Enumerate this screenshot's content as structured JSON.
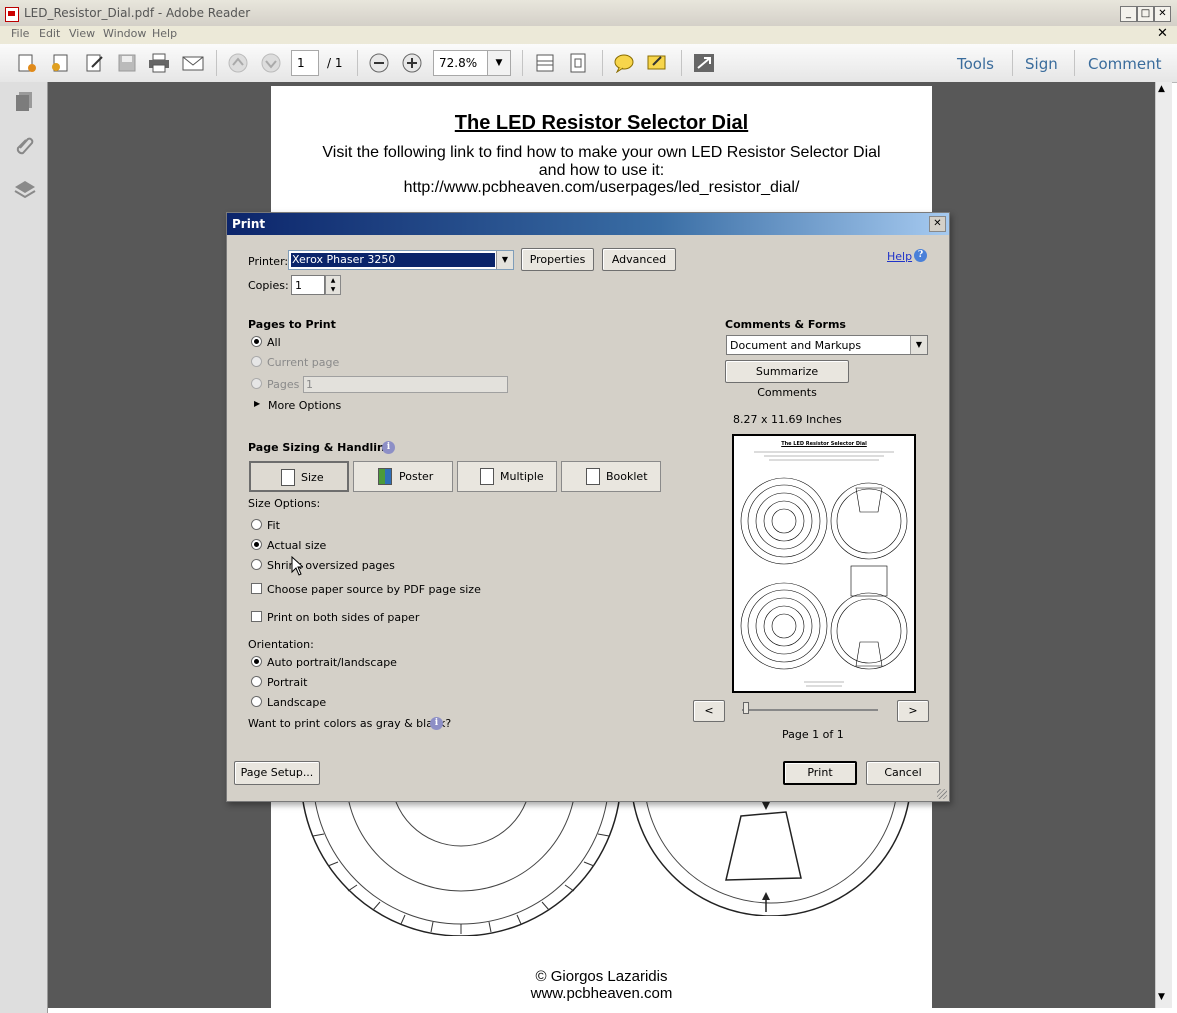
{
  "window": {
    "title": "LED_Resistor_Dial.pdf - Adobe Reader"
  },
  "menu": [
    "File",
    "Edit",
    "View",
    "Window",
    "Help"
  ],
  "toolbar": {
    "page_current": "1",
    "page_total": "/ 1",
    "zoom": "72.8%",
    "tools_label": "Tools",
    "sign_label": "Sign",
    "comment_label": "Comment"
  },
  "document": {
    "title": "The LED Resistor Selector Dial",
    "intro_line1": "Visit the following link to find how to make your own LED Resistor Selector Dial",
    "intro_line2": "and how to use it:",
    "link": "http://www.pcbheaven.com/userpages/led_resistor_dial/",
    "footer_line1": "© Giorgos Lazaridis",
    "footer_line2": "www.pcbheaven.com"
  },
  "print_dialog": {
    "title": "Print",
    "printer_label": "Printer:",
    "printer_value": "Xerox Phaser 3250",
    "properties_button": "Properties",
    "advanced_button": "Advanced",
    "help_link": "Help",
    "copies_label": "Copies:",
    "copies_value": "1",
    "pages_to_print": {
      "heading": "Pages to Print",
      "all": "All",
      "current_page": "Current page",
      "pages": "Pages",
      "pages_value": "1",
      "more_options": "More Options"
    },
    "page_sizing": {
      "heading": "Page Sizing & Handling",
      "tabs": [
        "Size",
        "Poster",
        "Multiple",
        "Booklet"
      ],
      "size_options_label": "Size Options:",
      "fit": "Fit",
      "actual_size": "Actual size",
      "shrink": "Shrink oversized pages",
      "choose_paper_source": "Choose paper source by PDF page size",
      "print_both_sides": "Print on both sides of paper"
    },
    "orientation": {
      "label": "Orientation:",
      "auto": "Auto portrait/landscape",
      "portrait": "Portrait",
      "landscape": "Landscape"
    },
    "gray_question": "Want to print colors as gray & black?",
    "comments_forms": {
      "heading": "Comments & Forms",
      "value": "Document and Markups",
      "summarize_button": "Summarize Comments"
    },
    "preview": {
      "size_label": "8.27 x 11.69 Inches",
      "prev_button": "<",
      "next_button": ">",
      "page_indicator": "Page 1 of 1"
    },
    "page_setup_button": "Page Setup...",
    "print_button": "Print",
    "cancel_button": "Cancel"
  }
}
